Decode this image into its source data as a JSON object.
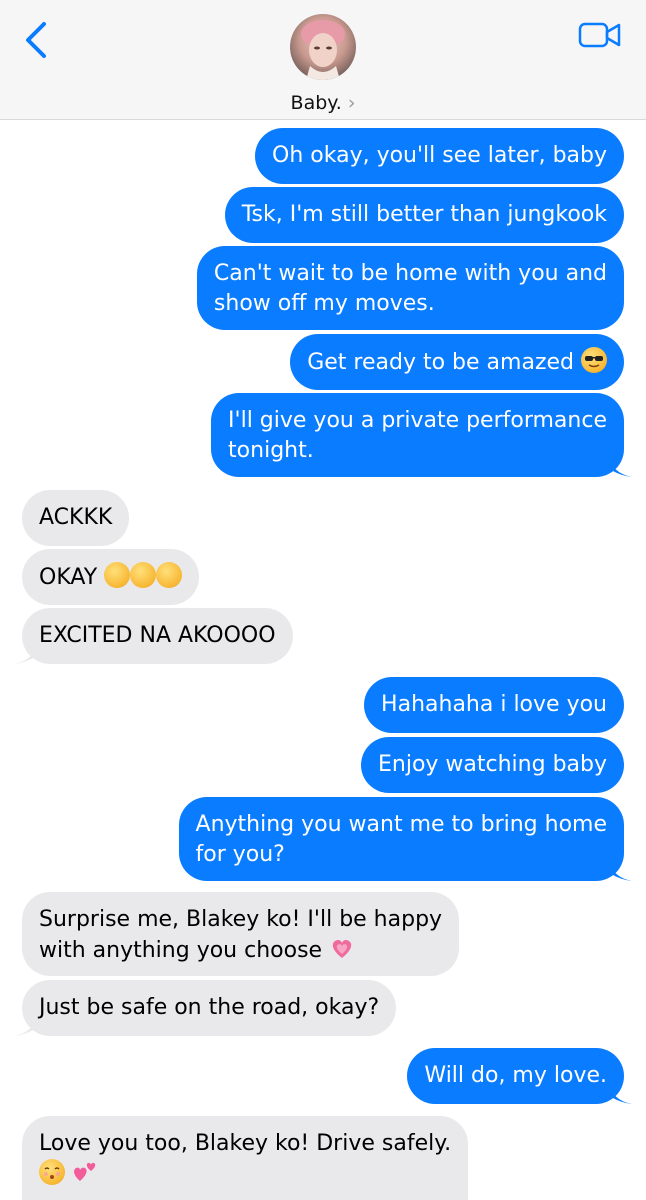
{
  "header": {
    "contact_name": "Baby.",
    "back_icon": "chevron-left-icon",
    "video_icon": "video-camera-icon",
    "accent_color": "#0a7cff"
  },
  "messages": [
    {
      "dir": "sent",
      "text": "Oh okay, you'll see later, baby"
    },
    {
      "dir": "sent",
      "text": "Tsk, I'm still better than jungkook"
    },
    {
      "dir": "sent",
      "line1": "Can't wait to be home with you and",
      "line2": "show off my moves."
    },
    {
      "dir": "sent",
      "text": "Get ready to be amazed",
      "emoji": "sunglasses-face"
    },
    {
      "dir": "sent",
      "line1": "I'll give you a private performance",
      "line2": "tonight."
    },
    {
      "dir": "received",
      "text": "ACKKK"
    },
    {
      "dir": "received",
      "text": "OKAY",
      "emoji": "hand-over-mouth x3"
    },
    {
      "dir": "received",
      "text": "EXCITED NA AKOOOO"
    },
    {
      "dir": "sent",
      "text": "Hahahaha i love you"
    },
    {
      "dir": "sent",
      "text": "Enjoy watching baby"
    },
    {
      "dir": "sent",
      "line1": "Anything you want me to bring home",
      "line2": "for you?"
    },
    {
      "dir": "received",
      "line1": "Surprise me, Blakey ko! I'll be happy",
      "line2": "with anything you choose",
      "emoji": "growing-heart"
    },
    {
      "dir": "received",
      "text": "Just be safe on the road, okay?"
    },
    {
      "dir": "sent",
      "text": "Will do, my love."
    },
    {
      "dir": "received",
      "line1": "Love you too, Blakey ko! Drive safely.",
      "emoji": "kissing-face and two-hearts"
    }
  ],
  "colors": {
    "sent_bubble": "#0a7cff",
    "received_bubble": "#e9e9eb"
  }
}
